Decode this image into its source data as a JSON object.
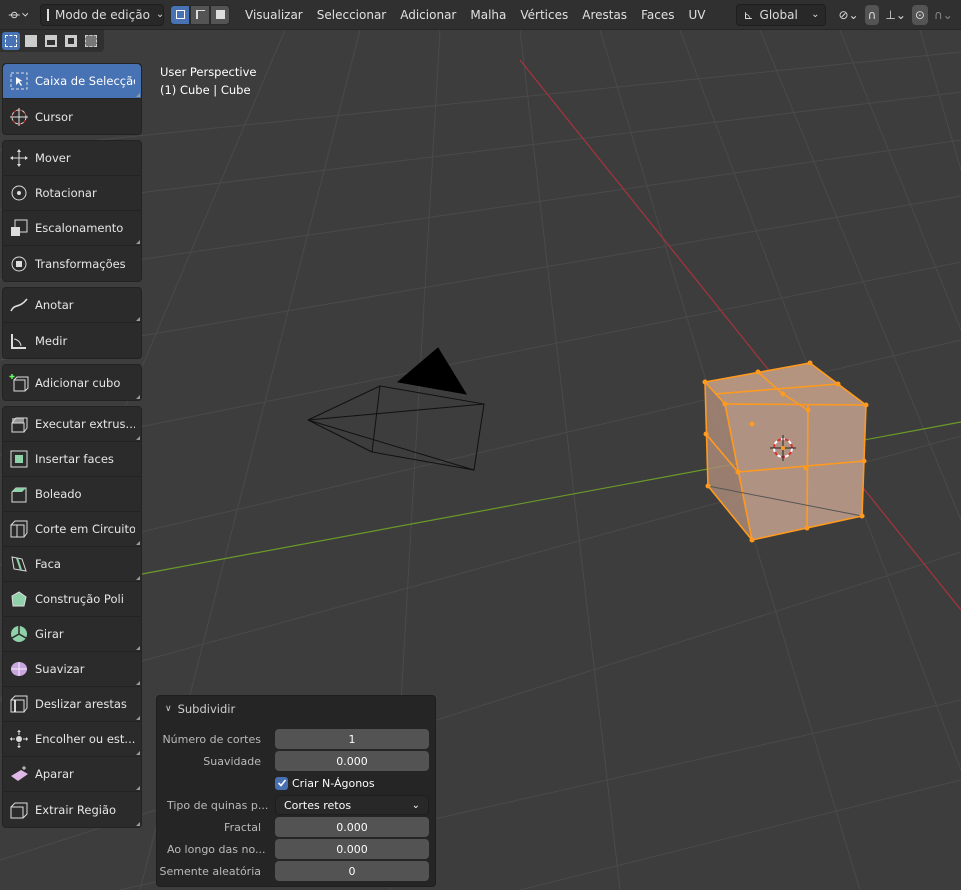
{
  "header": {
    "mode_label": "Modo de edição",
    "menus": [
      "Visualizar",
      "Seleccionar",
      "Adicionar",
      "Malha",
      "Vértices",
      "Arestas",
      "Faces",
      "UV"
    ],
    "orientation_label": "Global"
  },
  "viewport": {
    "perspective_label": "User Perspective",
    "object_label": "(1) Cube | Cube"
  },
  "toolbar": {
    "groups": [
      [
        {
          "label": "Caixa de Selecção",
          "icon": "select-box-icon",
          "active": true,
          "corner": true
        },
        {
          "label": "Cursor",
          "icon": "cursor-icon"
        }
      ],
      [
        {
          "label": "Mover",
          "icon": "move-icon"
        },
        {
          "label": "Rotacionar",
          "icon": "rotate-icon"
        },
        {
          "label": "Escalonamento",
          "icon": "scale-icon",
          "corner": true
        },
        {
          "label": "Transformações",
          "icon": "transform-icon"
        }
      ],
      [
        {
          "label": "Anotar",
          "icon": "annotate-icon",
          "corner": true
        },
        {
          "label": "Medir",
          "icon": "measure-icon"
        }
      ],
      [
        {
          "label": "Adicionar cubo",
          "icon": "add-cube-icon",
          "corner": true
        }
      ],
      [
        {
          "label": "Executar extrus...",
          "icon": "extrude-icon",
          "corner": true
        },
        {
          "label": "Insertar faces",
          "icon": "inset-faces-icon"
        },
        {
          "label": "Boleado",
          "icon": "bevel-icon"
        },
        {
          "label": "Corte em Circuito",
          "icon": "loop-cut-icon",
          "corner": true
        },
        {
          "label": "Faca",
          "icon": "knife-icon",
          "corner": true
        },
        {
          "label": "Construção Poli",
          "icon": "poly-build-icon"
        },
        {
          "label": "Girar",
          "icon": "spin-icon",
          "corner": true
        },
        {
          "label": "Suavizar",
          "icon": "smooth-icon",
          "corner": true
        },
        {
          "label": "Deslizar arestas",
          "icon": "edge-slide-icon",
          "corner": true
        },
        {
          "label": "Encolher ou est...",
          "icon": "shrink-fatten-icon",
          "corner": true
        },
        {
          "label": "Aparar",
          "icon": "shear-icon",
          "corner": true
        },
        {
          "label": "Extrair Região",
          "icon": "rip-region-icon",
          "corner": true
        }
      ]
    ]
  },
  "operator_panel": {
    "title": "Subdividir",
    "number_of_cuts_label": "Número de cortes",
    "number_of_cuts_value": "1",
    "smoothness_label": "Suavidade",
    "smoothness_value": "0.000",
    "create_ngons_label": "Criar N-Ágonos",
    "create_ngons_checked": true,
    "quad_corner_label": "Tipo de quinas p...",
    "quad_corner_value": "Cortes retos",
    "fractal_label": "Fractal",
    "fractal_value": "0.000",
    "along_normal_label": "Ao longo das no...",
    "along_normal_value": "0.000",
    "random_seed_label": "Semente aleatória",
    "random_seed_value": "0"
  },
  "colors": {
    "accent": "#4772b3",
    "selection": "#ff9a1f",
    "axis_x": "#a8333f",
    "axis_y": "#6a9a28"
  }
}
